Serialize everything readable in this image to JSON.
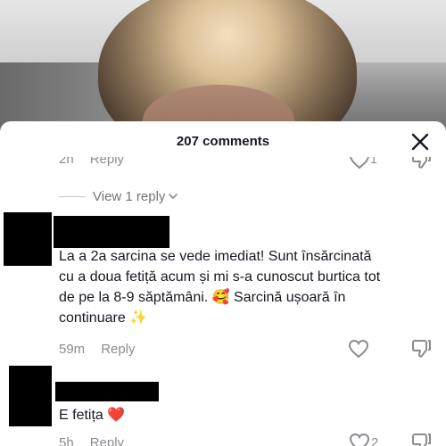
{
  "sheet": {
    "title": "207 comments"
  },
  "cut_comment": {
    "time": "2h",
    "reply_label": "Reply",
    "like_count": "1"
  },
  "view_replies": {
    "label": "View 1 reply"
  },
  "comments": [
    {
      "text_line1": "La a 2a sarcina se vede imediat! Sunt însărcinată",
      "text_line2": "cu a doua fetiță acum și mi s-a cunoscut burtica tot",
      "text_line3": "de pe la 8-9 săptămâni. 🥰 Sarcină ușoară în",
      "text_line4": "continuare ✨",
      "time": "59m",
      "reply_label": "Reply"
    },
    {
      "text_line1": "E fetița ❤️",
      "time": "5h",
      "reply_label": "Reply",
      "like_count": "2"
    }
  ],
  "colors": {
    "text": "#161823",
    "muted": "#8a8b91",
    "redaction": "#000000"
  },
  "icons": [
    "close-icon",
    "heart-icon",
    "dislike-icon",
    "chevron-down-icon"
  ]
}
